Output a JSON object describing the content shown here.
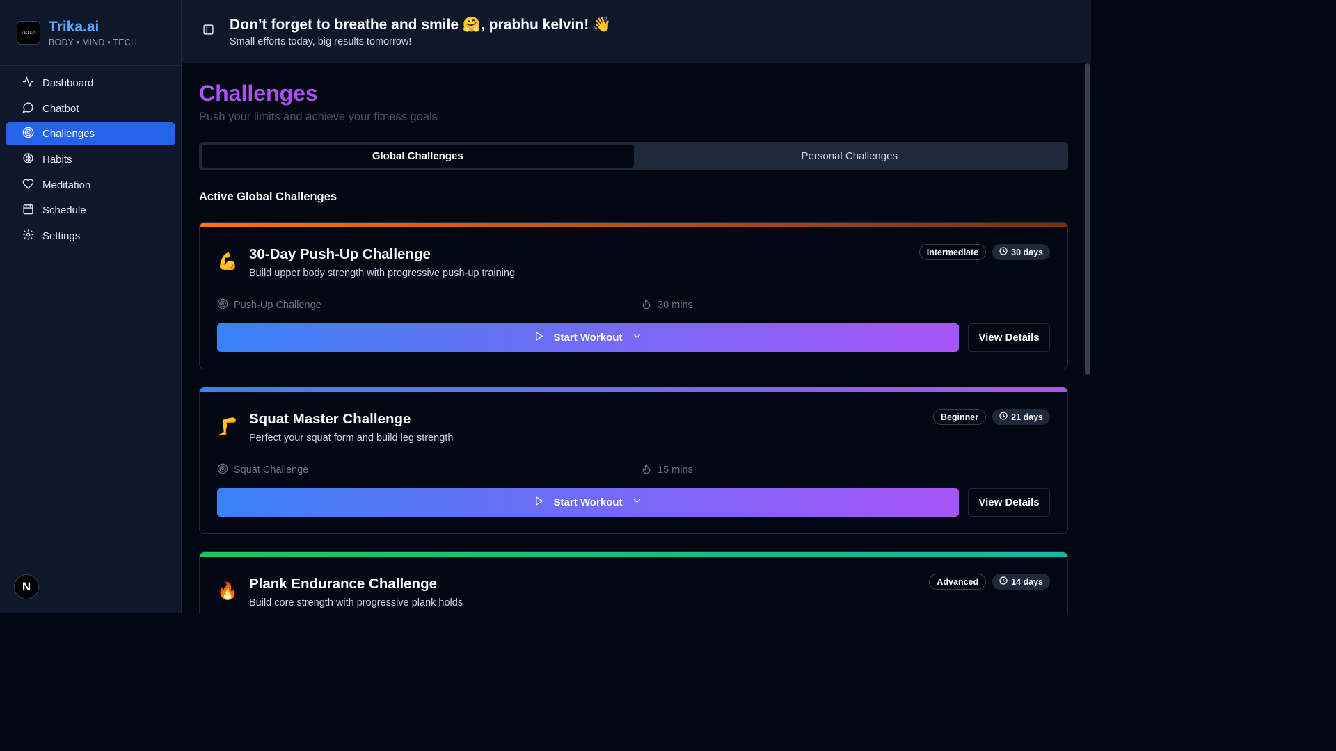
{
  "sidebar": {
    "brand": {
      "name": "Trika.ai",
      "tagline": "BODY • MIND • TECH",
      "logo_text": "TRIKA"
    },
    "items": [
      {
        "label": "Dashboard",
        "icon": "activity-icon",
        "active": false
      },
      {
        "label": "Chatbot",
        "icon": "chat-icon",
        "active": false
      },
      {
        "label": "Challenges",
        "icon": "target-icon",
        "active": true
      },
      {
        "label": "Habits",
        "icon": "brain-icon",
        "active": false
      },
      {
        "label": "Meditation",
        "icon": "heart-icon",
        "active": false
      },
      {
        "label": "Schedule",
        "icon": "calendar-icon",
        "active": false
      },
      {
        "label": "Settings",
        "icon": "gear-icon",
        "active": false
      }
    ],
    "avatar_letter": "N"
  },
  "header": {
    "greeting": "Don’t forget to breathe and smile 🤗, prabhu kelvin! 👋",
    "subtext": "Small efforts today, big results tomorrow!"
  },
  "page": {
    "title": "Challenges",
    "subtitle": "Push your limits and achieve your fitness goals",
    "tabs": [
      {
        "label": "Global Challenges",
        "active": true
      },
      {
        "label": "Personal Challenges",
        "active": false
      }
    ],
    "section_title": "Active Global Challenges"
  },
  "challenges": [
    {
      "emoji": "💪",
      "title": "30-Day Push-Up Challenge",
      "description": "Build upper body strength with progressive push-up training",
      "level": "Intermediate",
      "days": "30 days",
      "category": "Push-Up Challenge",
      "duration": "30 mins",
      "start_label": "Start Workout",
      "details_label": "View Details",
      "bar_gradient": [
        "#f97316",
        "#7c2d12"
      ]
    },
    {
      "emoji": "🦵",
      "title": "Squat Master Challenge",
      "description": "Perfect your squat form and build leg strength",
      "level": "Beginner",
      "days": "21 days",
      "category": "Squat Challenge",
      "duration": "15 mins",
      "start_label": "Start Workout",
      "details_label": "View Details",
      "bar_gradient": [
        "#3b82f6",
        "#a855f7"
      ]
    },
    {
      "emoji": "🔥",
      "title": "Plank Endurance Challenge",
      "description": "Build core strength with progressive plank holds",
      "level": "Advanced",
      "days": "14 days",
      "bar_gradient": [
        "#22c55e",
        "#14b8a6"
      ]
    }
  ],
  "colors": {
    "accent": "#2563eb",
    "title_gradient": [
      "#a855f7",
      "#c026d3"
    ],
    "button_gradient": [
      "#3b82f6",
      "#a855f7"
    ]
  }
}
